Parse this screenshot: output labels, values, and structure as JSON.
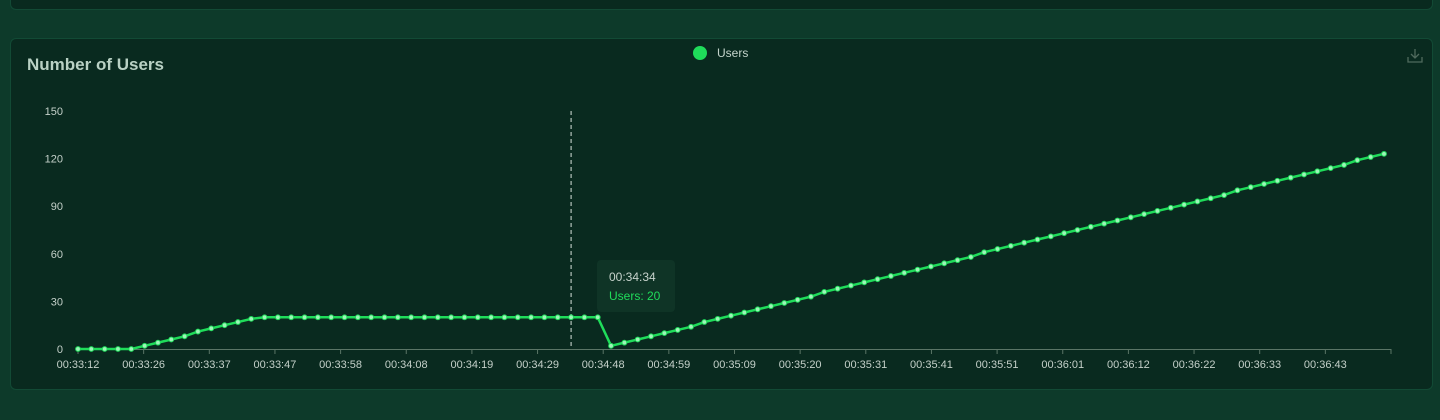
{
  "colors": {
    "background": "#0d3a2a",
    "card": "#092a1f",
    "series": "#1fdc5a",
    "text": "#c4d0c9"
  },
  "icons": {
    "download": "download-icon"
  },
  "tooltip": {
    "time": "00:34:34",
    "label": "Users: 20"
  },
  "chart_data": {
    "type": "line",
    "title": "Number of Users",
    "legend": {
      "position": "top-center",
      "entries": [
        "Users"
      ]
    },
    "xlabel": "",
    "ylabel": "",
    "ylim": [
      0,
      150
    ],
    "y_ticks": [
      0,
      30,
      60,
      90,
      120,
      150
    ],
    "x_tick_labels": [
      "00:33:12",
      "00:33:26",
      "00:33:37",
      "00:33:47",
      "00:33:58",
      "00:34:08",
      "00:34:19",
      "00:34:29",
      "00:34:48",
      "00:34:59",
      "00:35:09",
      "00:35:20",
      "00:35:31",
      "00:35:41",
      "00:35:51",
      "00:36:01",
      "00:36:12",
      "00:36:22",
      "00:36:33",
      "00:36:43"
    ],
    "grid": false,
    "hover_index": 37,
    "series": [
      {
        "name": "Users",
        "values": [
          0,
          0,
          0,
          0,
          0,
          2,
          4,
          6,
          8,
          11,
          13,
          15,
          17,
          19,
          20,
          20,
          20,
          20,
          20,
          20,
          20,
          20,
          20,
          20,
          20,
          20,
          20,
          20,
          20,
          20,
          20,
          20,
          20,
          20,
          20,
          20,
          20,
          20,
          20,
          20,
          2,
          4,
          6,
          8,
          10,
          12,
          14,
          17,
          19,
          21,
          23,
          25,
          27,
          29,
          31,
          33,
          36,
          38,
          40,
          42,
          44,
          46,
          48,
          50,
          52,
          54,
          56,
          58,
          61,
          63,
          65,
          67,
          69,
          71,
          73,
          75,
          77,
          79,
          81,
          83,
          85,
          87,
          89,
          91,
          93,
          95,
          97,
          100,
          102,
          104,
          106,
          108,
          110,
          112,
          114,
          116,
          119,
          121,
          123
        ]
      }
    ]
  }
}
